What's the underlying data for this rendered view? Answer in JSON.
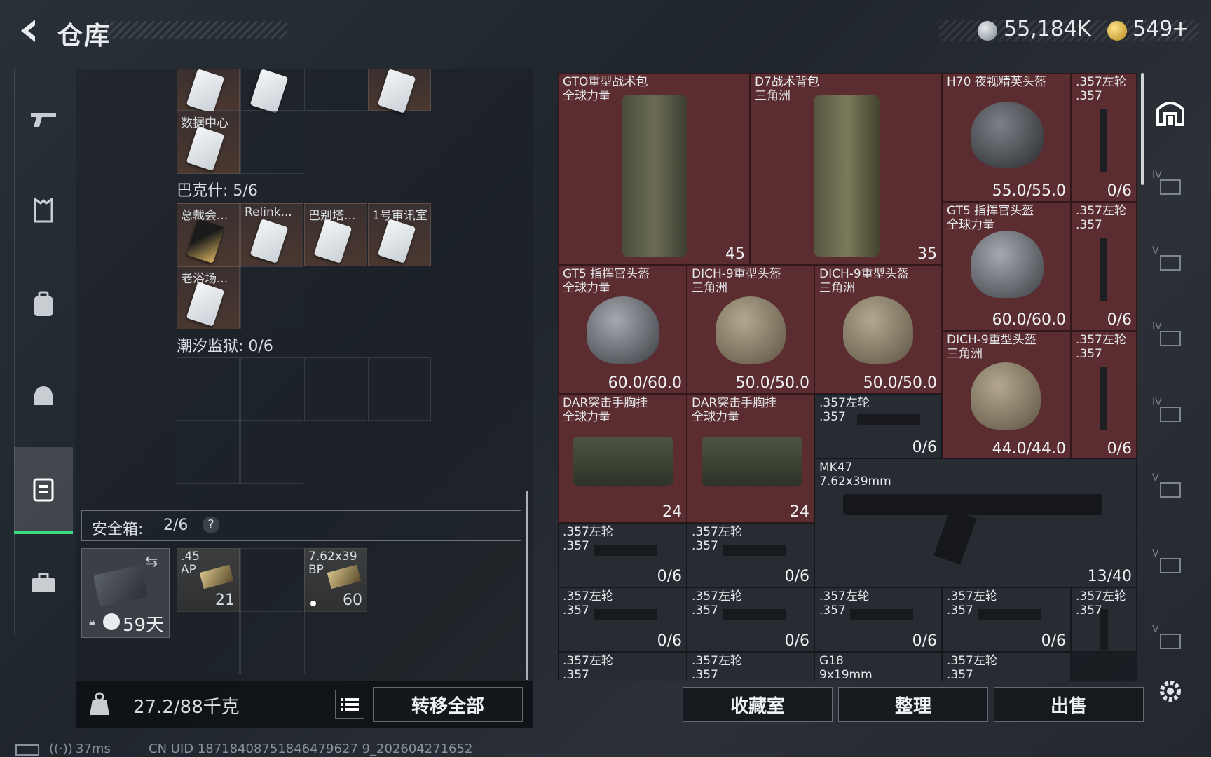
{
  "header": {
    "title": "仓库",
    "currency1": "55,184K",
    "currency2": "549",
    "plus": "+"
  },
  "left": {
    "cells_top": [
      {
        "label": "数据中心"
      }
    ],
    "section1": "巴克什: 5/6",
    "section1_items": [
      "总裁会...",
      "Relink...",
      "巴别塔...",
      "1号审讯室",
      "老浴场..."
    ],
    "section2": "潮汐监狱: 0/6",
    "safebox": {
      "label": "安全箱: ",
      "value": "2/6",
      "help": "?"
    },
    "safebox_items": [
      {
        "name": ".45\nAP",
        "count": "21"
      },
      {
        "name": "7.62x39\nBP",
        "count": "60"
      }
    ],
    "safebox_days": "59天",
    "weight": "27.2/88千克",
    "transfer_all": "转移全部"
  },
  "right": {
    "items": [
      {
        "name": "GTO重型战术包\n全球力量",
        "stat": "45"
      },
      {
        "name": "D7战术背包\n三角洲",
        "stat": "35"
      },
      {
        "name": "H70 夜视精英头盔",
        "stat": "55.0/55.0"
      },
      {
        "name": ".357左轮\n.357",
        "stat": "0/6"
      },
      {
        "name": "GT5 指挥官头盔\n全球力量",
        "stat": "60.0/60.0"
      },
      {
        "name": ".357左轮\n.357",
        "stat": "0/6"
      },
      {
        "name": "GT5 指挥官头盔\n全球力量",
        "stat": "60.0/60.0"
      },
      {
        "name": "DICH-9重型头盔\n三角洲",
        "stat": "50.0/50.0"
      },
      {
        "name": "DICH-9重型头盔\n三角洲",
        "stat": "50.0/50.0"
      },
      {
        "name": "DICH-9重型头盔\n三角洲",
        "stat": "44.0/44.0"
      },
      {
        "name": ".357左轮\n.357",
        "stat": "0/6"
      },
      {
        "name": "DAR突击手胸挂\n全球力量",
        "stat": "24"
      },
      {
        "name": "DAR突击手胸挂\n全球力量",
        "stat": "24"
      },
      {
        "name": ".357左轮\n.357",
        "stat": "0/6"
      },
      {
        "name": "MK47\n7.62x39mm",
        "stat": "13/40"
      },
      {
        "name": ".357左轮\n.357",
        "stat": "0/6"
      },
      {
        "name": ".357左轮\n.357",
        "stat": "0/6"
      },
      {
        "name": ".357左轮\n.357",
        "stat": "0/6"
      },
      {
        "name": ".357左轮\n.357",
        "stat": "0/6"
      },
      {
        "name": ".357左轮\n.357",
        "stat": "0/6"
      },
      {
        "name": ".357左轮\n.357",
        "stat": "0/6"
      },
      {
        "name": ".357左轮\n.357",
        "stat": ""
      },
      {
        "name": ".357左轮\n.357",
        "stat": ""
      },
      {
        "name": ".357左轮\n.357",
        "stat": ""
      },
      {
        "name": "G18\n9x19mm",
        "stat": ""
      },
      {
        "name": ".357左轮\n.357",
        "stat": ""
      }
    ],
    "buttons": {
      "collection": "收藏室",
      "sort": "整理",
      "sell": "出售"
    },
    "side_tags": [
      "IV",
      "V",
      "IV",
      "IV",
      "V",
      "V",
      "V"
    ]
  },
  "footer": {
    "ping": "37ms",
    "uid": "CN UID 18718408751846479627 9_202604271652"
  },
  "colors": {
    "accent": "#3ddc84",
    "red_cell": "#5b2c30"
  }
}
